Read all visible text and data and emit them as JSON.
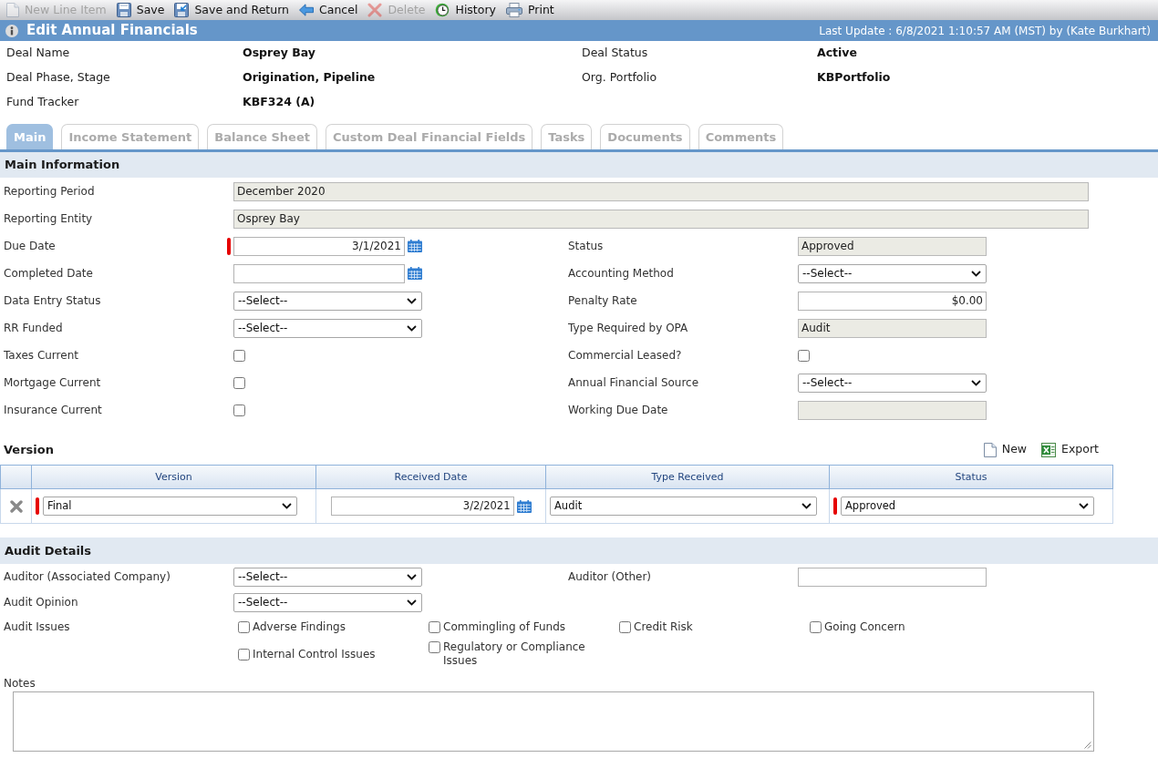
{
  "toolbar": [
    {
      "label": "New Line Item",
      "disabled": true
    },
    {
      "label": "Save",
      "disabled": false
    },
    {
      "label": "Save and Return",
      "disabled": false
    },
    {
      "label": "Cancel",
      "disabled": false
    },
    {
      "label": "Delete",
      "disabled": true
    },
    {
      "label": "History",
      "disabled": false
    },
    {
      "label": "Print",
      "disabled": false
    }
  ],
  "header": {
    "title": "Edit Annual Financials",
    "last_update": "Last Update : 6/8/2021 1:10:57 AM (MST) by (Kate Burkhart)"
  },
  "deal_info": [
    {
      "label": "Deal Name",
      "value": "Osprey Bay"
    },
    {
      "label": "Deal Status",
      "value": "Active"
    },
    {
      "label": "Deal Phase, Stage",
      "value": "Origination, Pipeline"
    },
    {
      "label": "Org. Portfolio",
      "value": "KBPortfolio"
    },
    {
      "label": "Fund Tracker",
      "value": "KBF324 (A)"
    }
  ],
  "tabs": [
    {
      "label": "Main",
      "selected": true
    },
    {
      "label": "Income Statement",
      "selected": false
    },
    {
      "label": "Balance Sheet",
      "selected": false
    },
    {
      "label": "Custom Deal Financial Fields",
      "selected": false
    },
    {
      "label": "Tasks",
      "selected": false
    },
    {
      "label": "Documents",
      "selected": false
    },
    {
      "label": "Comments",
      "selected": false
    }
  ],
  "main_information": {
    "title": "Main Information",
    "wide_fields": [
      {
        "label": "Reporting Period",
        "value": "December 2020"
      },
      {
        "label": "Reporting Entity",
        "value": "Osprey Bay"
      }
    ],
    "fields": [
      {
        "label": "Due Date",
        "kind": "date",
        "value": "3/1/2021",
        "required": true
      },
      {
        "label": "Status",
        "kind": "readonly",
        "value": "Approved",
        "required": false
      },
      {
        "label": "Completed Date",
        "kind": "date",
        "required": false
      },
      {
        "label": "Accounting Method",
        "kind": "select",
        "value": "--Select--",
        "required": false
      },
      {
        "label": "Data Entry Status",
        "kind": "select",
        "value": "--Select--",
        "required": false
      },
      {
        "label": "Penalty Rate",
        "kind": "money",
        "value": "$0.00",
        "required": false
      },
      {
        "label": "RR Funded",
        "kind": "select",
        "value": "--Select--",
        "required": false
      },
      {
        "label": "Type Required by OPA",
        "kind": "readonly",
        "value": "Audit",
        "required": false
      },
      {
        "label": "Taxes Current",
        "kind": "checkbox",
        "checked": false,
        "required": false
      },
      {
        "label": "Commercial Leased?",
        "kind": "checkbox",
        "checked": false,
        "required": false
      },
      {
        "label": "Mortgage Current",
        "kind": "checkbox",
        "checked": false,
        "required": false
      },
      {
        "label": "Annual Financial Source",
        "kind": "select",
        "value": "--Select--",
        "required": false
      },
      {
        "label": "Insurance Current",
        "kind": "checkbox",
        "checked": false,
        "required": false
      },
      {
        "label": "Working Due Date",
        "kind": "readonly",
        "required": false
      }
    ]
  },
  "version": {
    "title": "Version",
    "actions": [
      {
        "label": "New"
      },
      {
        "label": "Export"
      }
    ],
    "columns": [
      "Version",
      "Received Date",
      "Type Received",
      "Status"
    ],
    "rows": [
      {
        "cells": [
          {
            "kind": "select",
            "value": "Final",
            "required": true
          },
          {
            "kind": "date",
            "value": "3/2/2021",
            "required": false
          },
          {
            "kind": "select",
            "value": "Audit",
            "required": false
          },
          {
            "kind": "select",
            "value": "Approved",
            "required": true
          }
        ]
      }
    ]
  },
  "audit_details": {
    "title": "Audit Details",
    "fields": [
      {
        "label": "Auditor (Associated Company)",
        "kind": "select",
        "value": "--Select--"
      },
      {
        "label": "Auditor (Other)",
        "kind": "text"
      },
      {
        "label": "Audit Opinion",
        "kind": "select",
        "value": "--Select--"
      }
    ],
    "issues_label": "Audit Issues",
    "issues": [
      {
        "label": "Adverse Findings",
        "checked": false
      },
      {
        "label": "Commingling of Funds",
        "checked": false
      },
      {
        "label": "Credit Risk",
        "checked": false
      },
      {
        "label": "Going Concern",
        "checked": false
      },
      {
        "label": "Internal Control Issues",
        "checked": false
      },
      {
        "label": "Regulatory or Compliance Issues",
        "checked": false
      }
    ],
    "notes_label": "Notes"
  }
}
